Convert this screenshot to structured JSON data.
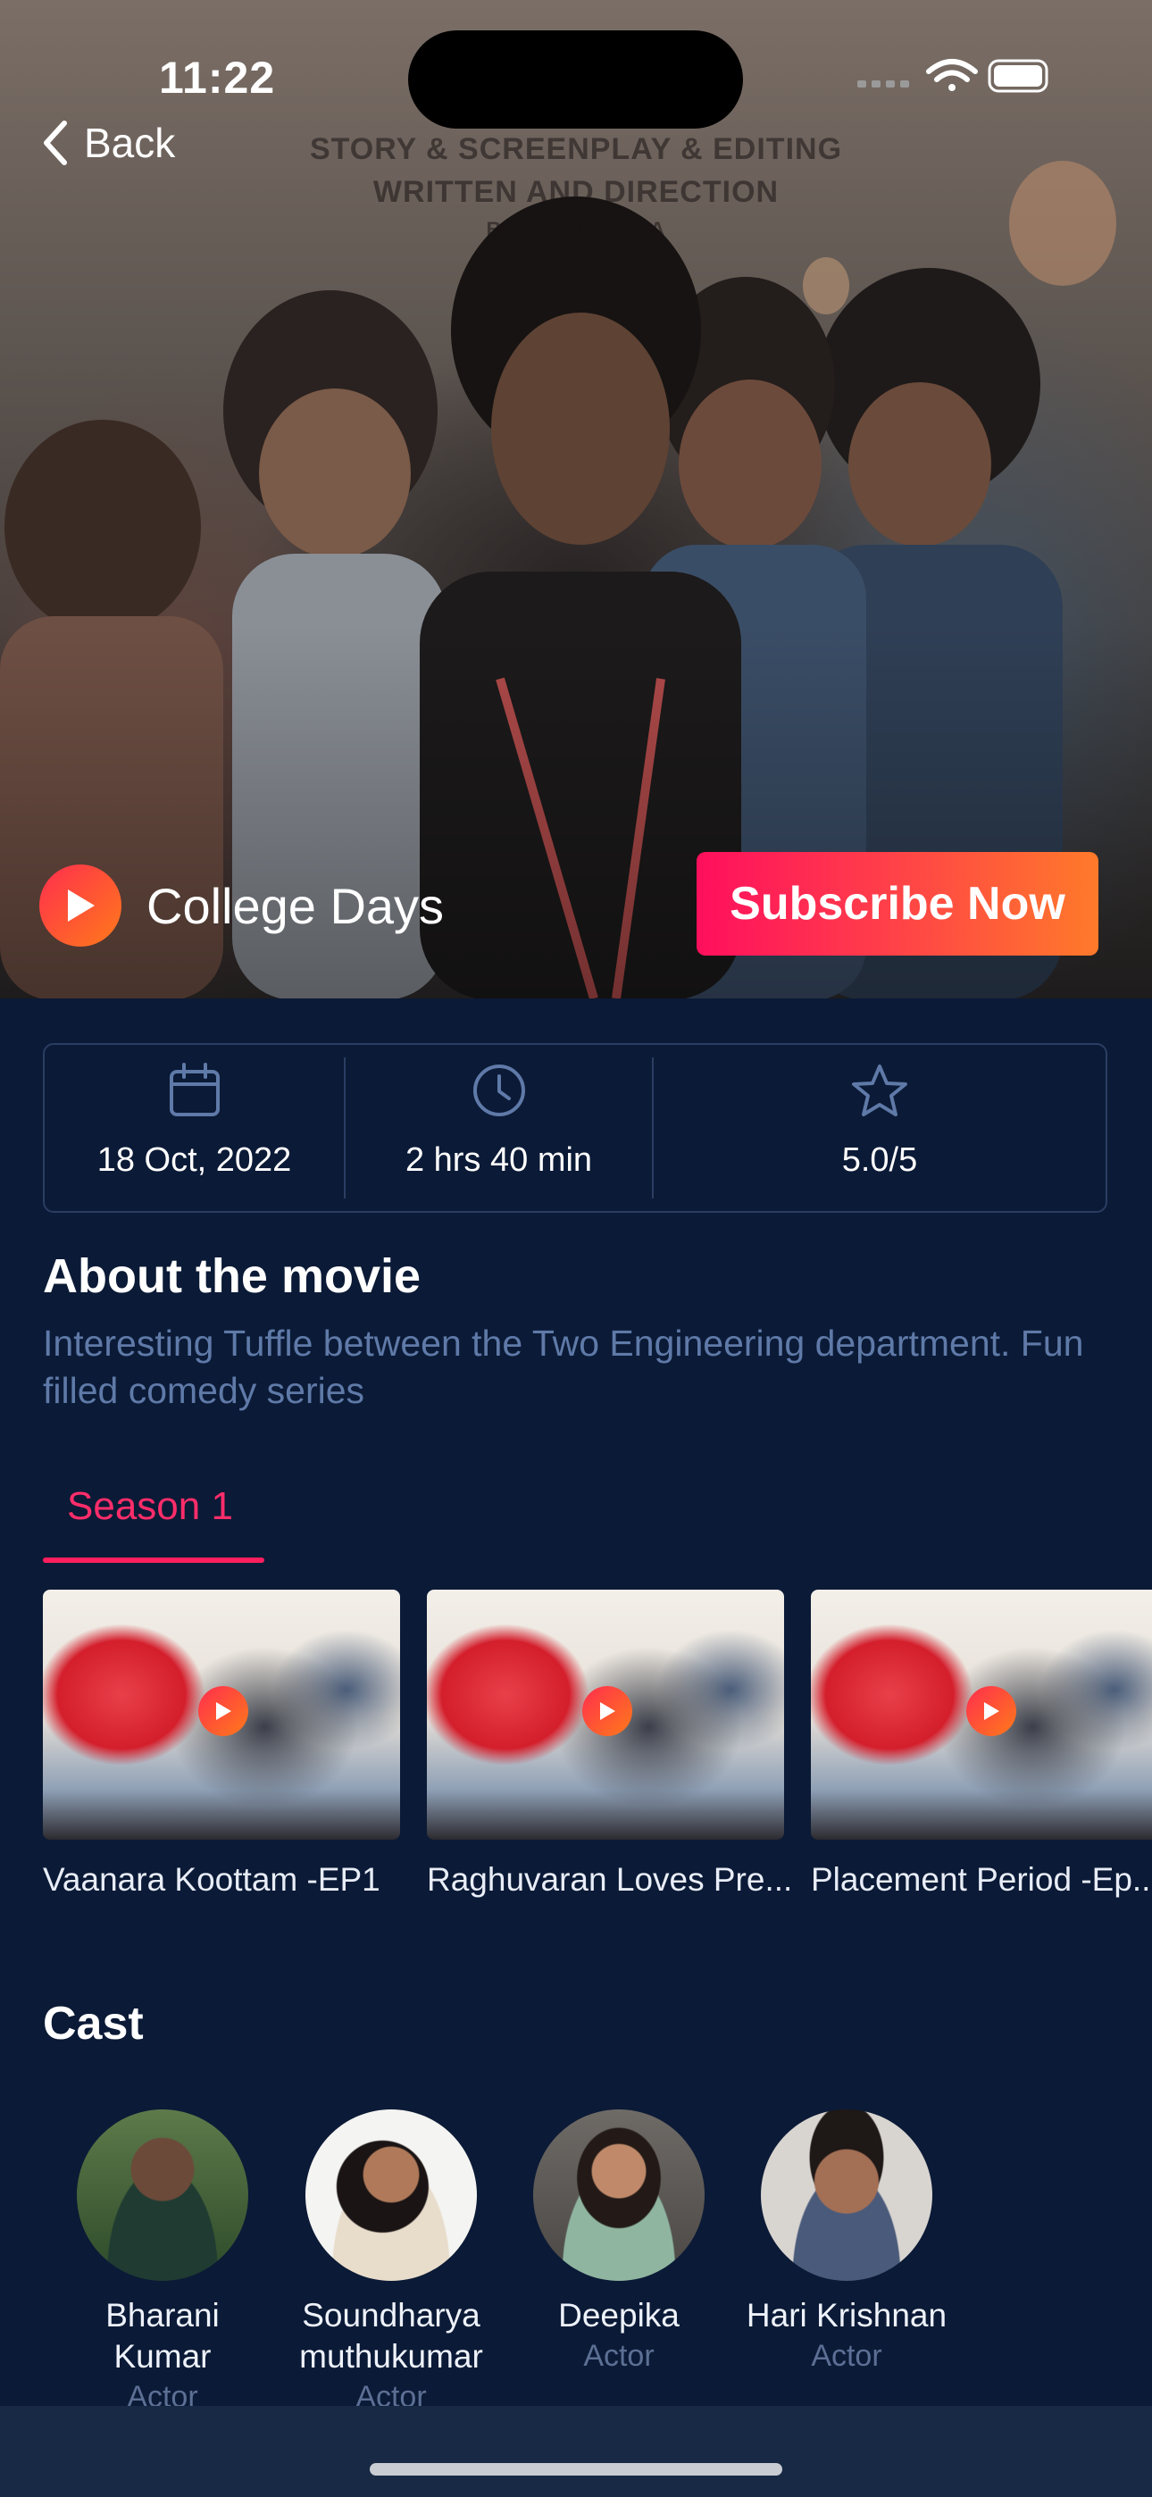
{
  "status_bar": {
    "time": "11:22"
  },
  "nav": {
    "back_label": "Back"
  },
  "hero": {
    "poster_lines": [
      "STORY & SCREENPLAY & EDITING",
      "WRITTEN AND DIRECTION",
      "BHARANI KUMA"
    ],
    "movie_title": "College Days",
    "subscribe_label": "Subscribe Now"
  },
  "info": {
    "date": "18 Oct, 2022",
    "duration": "2 hrs 40 min",
    "rating": "5.0/5"
  },
  "about": {
    "title": "About the movie",
    "description": "Interesting Tuffle between the Two Engineering department. Fun filled comedy series"
  },
  "season_tab": {
    "label": "Season 1"
  },
  "episodes": [
    {
      "title": "Vaanara Koottam -EP1"
    },
    {
      "title": "Raghuvaran Loves Pre..."
    },
    {
      "title": "Placement Period -Ep..."
    }
  ],
  "cast": {
    "title": "Cast",
    "members": [
      {
        "name_line1": "Bharani",
        "name_line2": "Kumar",
        "role": "Actor"
      },
      {
        "name_line1": "Soundharya",
        "name_line2": "muthukumar",
        "role": "Actor"
      },
      {
        "name_line1": "Deepika",
        "name_line2": "",
        "role": "Actor"
      },
      {
        "name_line1": "Hari Krishnan",
        "name_line2": "",
        "role": "Actor"
      }
    ]
  },
  "colors": {
    "background": "#0b1a36",
    "accent_pink": "#ff1f5e",
    "accent_orange": "#ff7a2a",
    "muted_text": "#5f7aa8",
    "border": "#2b3d63"
  },
  "icons": {
    "back": "chevron-left-icon",
    "play": "play-icon",
    "date": "calendar-icon",
    "duration": "clock-icon",
    "rating": "star-icon"
  }
}
